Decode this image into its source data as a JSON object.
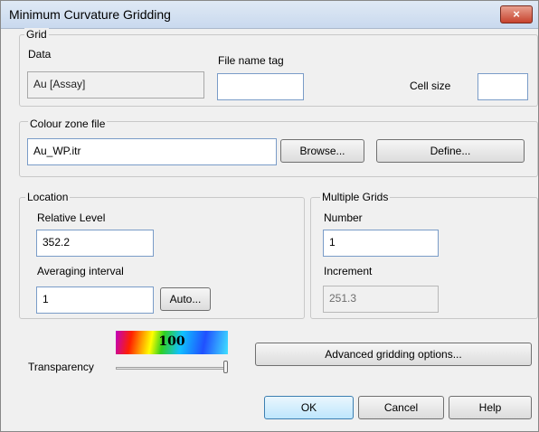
{
  "window": {
    "title": "Minimum Curvature Gridding",
    "close_icon": "×"
  },
  "grid": {
    "label": "Grid",
    "data_label": "Data",
    "data_value": "Au [Assay]",
    "file_name_tag_label": "File name tag",
    "file_name_tag_value": "",
    "cell_size_label": "Cell size",
    "cell_size_value": ""
  },
  "colour_zone": {
    "label": "Colour zone file",
    "file_value": "Au_WP.itr",
    "browse_label": "Browse...",
    "define_label": "Define..."
  },
  "location": {
    "label": "Location",
    "relative_level_label": "Relative Level",
    "relative_level_value": "352.2",
    "averaging_interval_label": "Averaging interval",
    "averaging_interval_value": "1",
    "auto_label": "Auto..."
  },
  "multiple_grids": {
    "label": "Multiple Grids",
    "number_label": "Number",
    "number_value": "1",
    "increment_label": "Increment",
    "increment_value": "251.3"
  },
  "transparency": {
    "label": "Transparency",
    "value": "100",
    "fraction": 1.0
  },
  "buttons": {
    "advanced_label": "Advanced gridding options...",
    "ok_label": "OK",
    "cancel_label": "Cancel",
    "help_label": "Help"
  },
  "colors": {
    "title_gradient_top": "#dfe9f5",
    "close_red": "#c7432e",
    "field_border": "#7a9cc8"
  }
}
